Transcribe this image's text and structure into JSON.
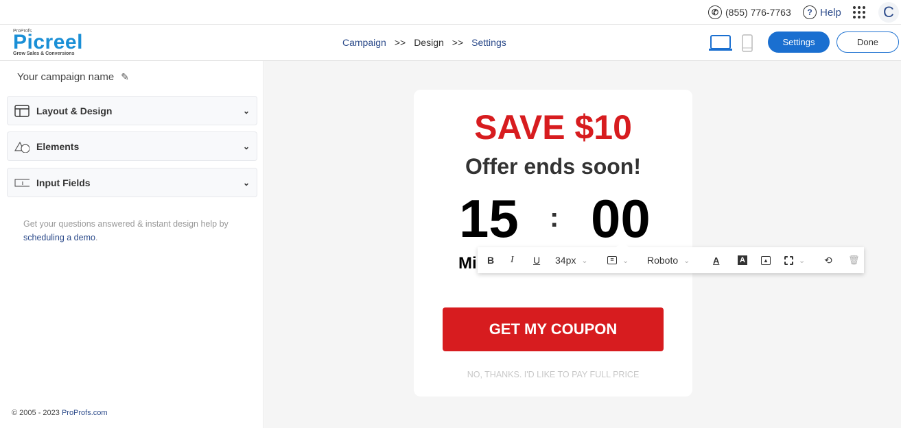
{
  "topbar": {
    "phone": "(855) 776-7763",
    "help": "Help",
    "avatar_initial": "C"
  },
  "header": {
    "logo_brand": "ProProfs",
    "logo_name": "Picreel",
    "logo_tagline": "Grow Sales & Conversions",
    "breadcrumbs": [
      "Campaign",
      ">>",
      "Design",
      ">>",
      "Settings"
    ],
    "settings_label": "Settings",
    "done_label": "Done",
    "device_active": "desktop"
  },
  "sidebar": {
    "campaign_name": "Your campaign name",
    "sections": [
      {
        "label": "Layout & Design",
        "icon": "layout-icon"
      },
      {
        "label": "Elements",
        "icon": "shapes-icon"
      },
      {
        "label": "Input Fields",
        "icon": "input-field-icon"
      }
    ],
    "help_text": "Get your questions answered & instant design help by ",
    "help_link": "scheduling a demo",
    "help_end": ".",
    "footer_text": "© 2005 - 2023 ",
    "footer_link": "ProProfs.com"
  },
  "popup": {
    "headline": "SAVE $10",
    "subheadline": "Offer ends soon!",
    "minutes": "15",
    "separator": ":",
    "seconds": "00",
    "minutes_label_visible": "Mi",
    "cta": "GET MY COUPON",
    "decline": "NO, THANKS. I'D LIKE TO PAY FULL PRICE",
    "colors": {
      "accent": "#d71c1f",
      "primary": "#1a6fd0"
    }
  },
  "toolbar": {
    "bold": "B",
    "italic": "I",
    "underline": "U",
    "font_size": "34px",
    "font_family": "Roboto"
  }
}
